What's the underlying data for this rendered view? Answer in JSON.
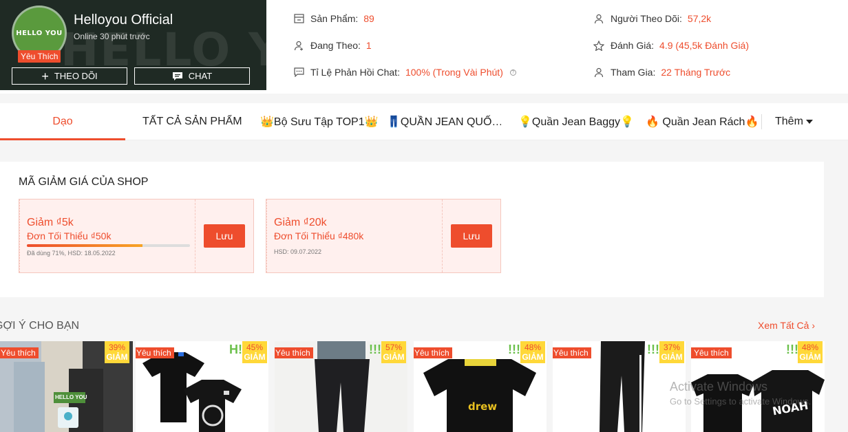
{
  "shop": {
    "avatar_text": "HELLO YOU",
    "bg_watermark": "HELLO YOU",
    "favorite_badge": "Yêu Thích",
    "name": "Helloyou Official",
    "status": "Online 30 phút trước",
    "follow_label": "THEO DÕI",
    "chat_label": "CHAT"
  },
  "stats": {
    "products_label": "Sản Phẩm:",
    "products_value": "89",
    "following_label": "Đang Theo:",
    "following_value": "1",
    "chat_rate_label": "Tỉ Lệ Phản Hồi Chat:",
    "chat_rate_value": "100% (Trong Vài Phút)",
    "followers_label": "Người Theo Dõi:",
    "followers_value": "57,2k",
    "rating_label": "Đánh Giá:",
    "rating_value": "4.9 (45,5k Đánh Giá)",
    "joined_label": "Tham Gia:",
    "joined_value": "22 Tháng Trước"
  },
  "nav": {
    "tabs": [
      "Dạo",
      "TẤT CẢ SẢN PHẨM",
      "👑Bộ Sưu Tập TOP1👑",
      "👖QUẦN JEAN QUỐ…",
      "💡Quần Jean Baggy💡",
      "🔥 Quần Jean Rách🔥"
    ],
    "more_label": "Thêm"
  },
  "vouchers": {
    "title": "MÃ GIẢM GIÁ CỦA SHOP",
    "items": [
      {
        "title": "Giảm ₫5k",
        "condition": "Đơn Tối Thiểu ₫50k",
        "used_pct": 71,
        "meta": "Đã dùng 71%, HSD: 18.05.2022",
        "button": "Lưu"
      },
      {
        "title": "Giảm ₫20k",
        "condition": "Đơn Tối Thiểu ₫480k",
        "meta": "HSD: 09.07.2022",
        "button": "Lưu"
      }
    ]
  },
  "recommend": {
    "title": "GỢI Ý CHO BẠN",
    "see_all": "Xem Tất Cả",
    "products": [
      {
        "badge": "Yêu thích",
        "discount": "39%",
        "discount_label": "GIẢM"
      },
      {
        "badge": "Yêu thích",
        "discount": "45%",
        "discount_label": "GIẢM"
      },
      {
        "badge": "Yêu thích",
        "discount": "57%",
        "discount_label": "GIẢM"
      },
      {
        "badge": "Yêu thích",
        "discount": "48%",
        "discount_label": "GIẢM"
      },
      {
        "badge": "Yêu thích",
        "discount": "37%",
        "discount_label": "GIẢM"
      },
      {
        "badge": "Yêu thích",
        "discount": "48%",
        "discount_label": "GIẢM"
      }
    ]
  },
  "product_art": {
    "tag_text": "HELLO YOU",
    "shirt_print": "drew",
    "shirt_print_2": "NOAH"
  },
  "watermark": {
    "line1": "Activate Windows",
    "line2": "Go to Settings to activate Windows."
  }
}
